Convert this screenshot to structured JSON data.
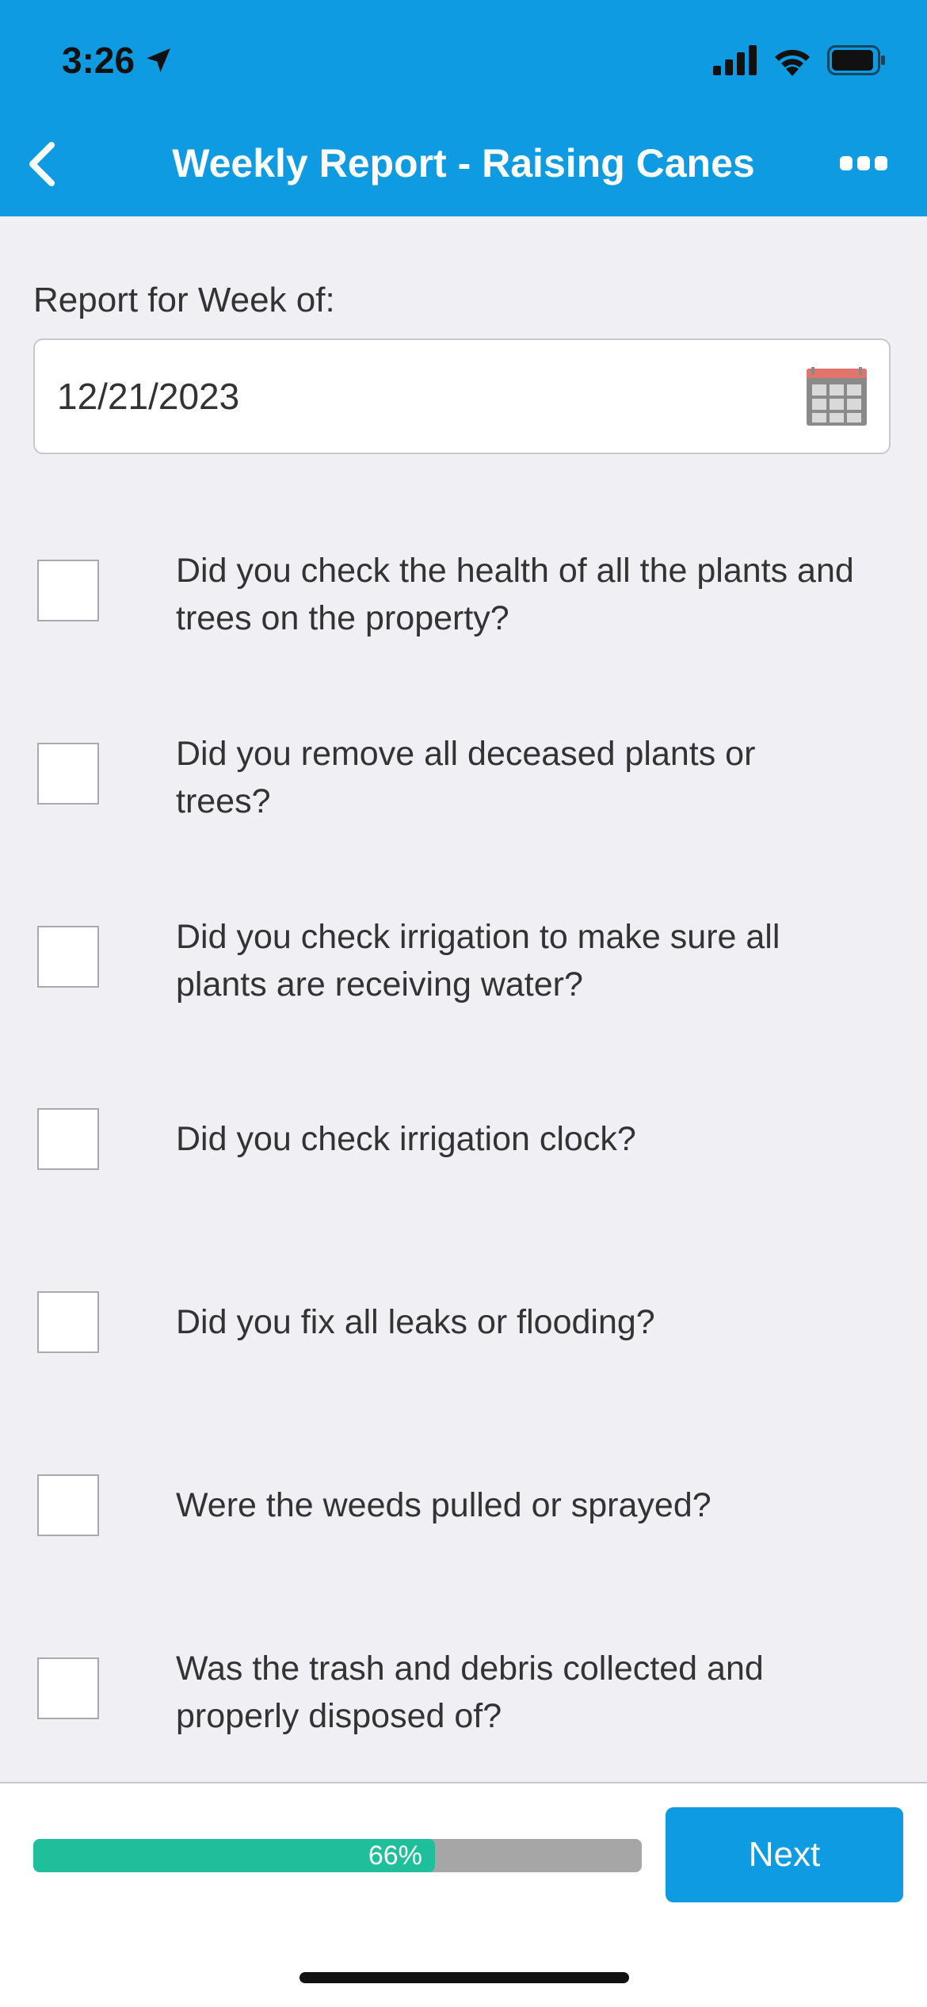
{
  "status_bar": {
    "time": "3:26",
    "icons": [
      "location-arrow-icon",
      "cellular-signal-icon",
      "wifi-icon",
      "battery-icon"
    ]
  },
  "nav": {
    "title": "Weekly Report - Raising Canes",
    "back_icon": "chevron-left-icon",
    "more_icon": "more-dots-icon"
  },
  "form": {
    "week_label": "Report for Week of:",
    "date_value": "12/21/2023",
    "date_icon": "calendar-icon",
    "questions": [
      {
        "text": "Did you check the health of all the plants and trees on the property?",
        "checked": false
      },
      {
        "text": "Did you remove all deceased plants or trees?",
        "checked": false
      },
      {
        "text": "Did you check irrigation to make sure all plants are receiving water?",
        "checked": false
      },
      {
        "text": "Did you check irrigation clock?",
        "checked": false
      },
      {
        "text": "Did you fix all leaks or flooding?",
        "checked": false
      },
      {
        "text": "Were the weeds pulled or sprayed?",
        "checked": false
      },
      {
        "text": "Was the trash and debris collected and properly disposed of?",
        "checked": false
      }
    ]
  },
  "footer": {
    "progress_percent": 66,
    "progress_label": "66%",
    "next_label": "Next"
  },
  "colors": {
    "header_bg": "#0f9be2",
    "progress_fill": "#1fbf9c",
    "progress_track": "#a6a6a6",
    "page_bg": "#efeff4"
  }
}
